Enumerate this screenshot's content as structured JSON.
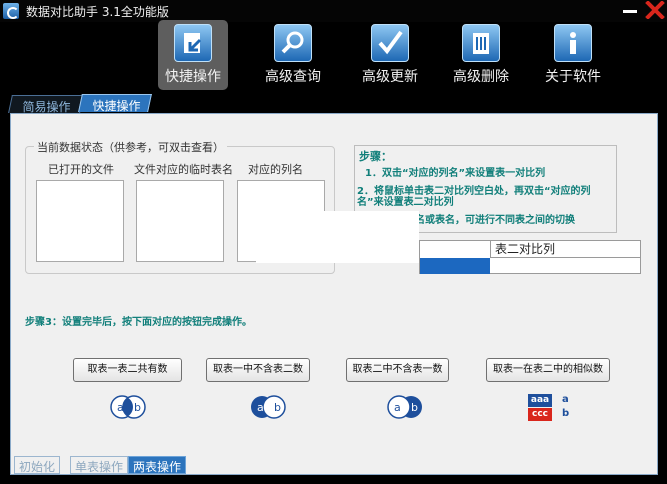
{
  "window": {
    "title": "数据对比助手 3.1全功能版"
  },
  "toolbar": {
    "items": [
      {
        "label": "快捷操作",
        "icon": "quick-operation-icon",
        "active": true
      },
      {
        "label": "高级查询",
        "icon": "search-icon"
      },
      {
        "label": "高级更新",
        "icon": "checkmark-icon"
      },
      {
        "label": "高级删除",
        "icon": "trash-icon"
      },
      {
        "label": "关于软件",
        "icon": "info-icon"
      }
    ]
  },
  "tabs": {
    "simple": "简易操作",
    "quick": "快捷操作"
  },
  "status_group": {
    "title": "当前数据状态（供参考，可双击查看）",
    "col_opened": "已打开的文件",
    "col_temp": "文件对应的临时表名",
    "col_columns": "对应的列名"
  },
  "steps": {
    "title": "步骤：",
    "step1": "1．双击“对应的列名”来设置表一对比列",
    "step2": "2．将鼠标单击表二对比列空白处，再双击“对应的列名”来设置表二对比列",
    "step3_partial": "名或表名，可进行不同表之间的切换"
  },
  "compare_table": {
    "header": "表二对比列"
  },
  "step3_text": "步骤3：设置完毕后，按下面对应的按钮完成操作。",
  "buttons": {
    "common": "取表一表二共有数",
    "in1_not2": "取表一中不含表二数",
    "in2_not1": "取表二中不含表一数",
    "similar": "取表一在表二中的相似数"
  },
  "venn_labels": {
    "a": "a",
    "b": "b"
  },
  "similar_icon": {
    "top": "aaa",
    "bottom": "ccc"
  },
  "bottom_tabs": {
    "init": "初始化",
    "single": "单表操作",
    "double": "两表操作"
  },
  "colors": {
    "accent": "#2c74bd",
    "step_text": "#117f7a",
    "close": "#d9261c"
  }
}
